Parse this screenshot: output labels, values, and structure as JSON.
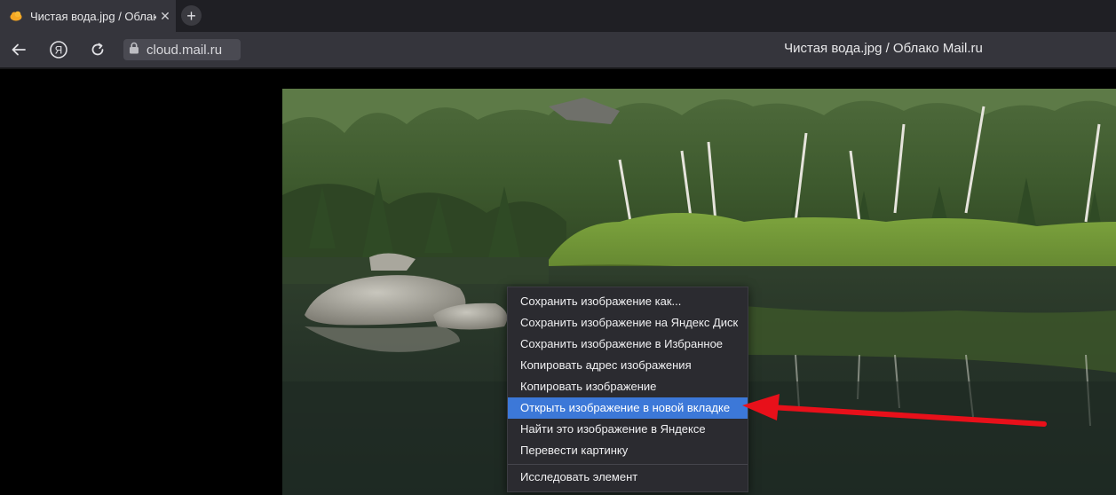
{
  "tab": {
    "title": "Чистая вода.jpg / Облако Mail.ru"
  },
  "toolbar": {
    "url": "cloud.mail.ru",
    "page_title": "Чистая вода.jpg / Облако Mail.ru"
  },
  "icons": {
    "tab_favicon": "mail-cloud-icon",
    "tab_close": "close-icon",
    "new_tab": "plus-icon",
    "back": "back-arrow-icon",
    "yandex": "yandex-logo-icon",
    "reload": "reload-icon",
    "lock": "lock-icon"
  },
  "context_menu": {
    "items": [
      "Сохранить изображение как...",
      "Сохранить изображение на Яндекс Диск",
      "Сохранить изображение в Избранное",
      "Копировать адрес изображения",
      "Копировать изображение",
      "Открыть изображение в новой вкладке",
      "Найти это изображение в Яндексе",
      "Перевести картинку",
      "Исследовать элемент"
    ],
    "highlighted_index": 5
  },
  "colors": {
    "highlight": "#3c78d8",
    "annotation_arrow": "#e8101a"
  }
}
